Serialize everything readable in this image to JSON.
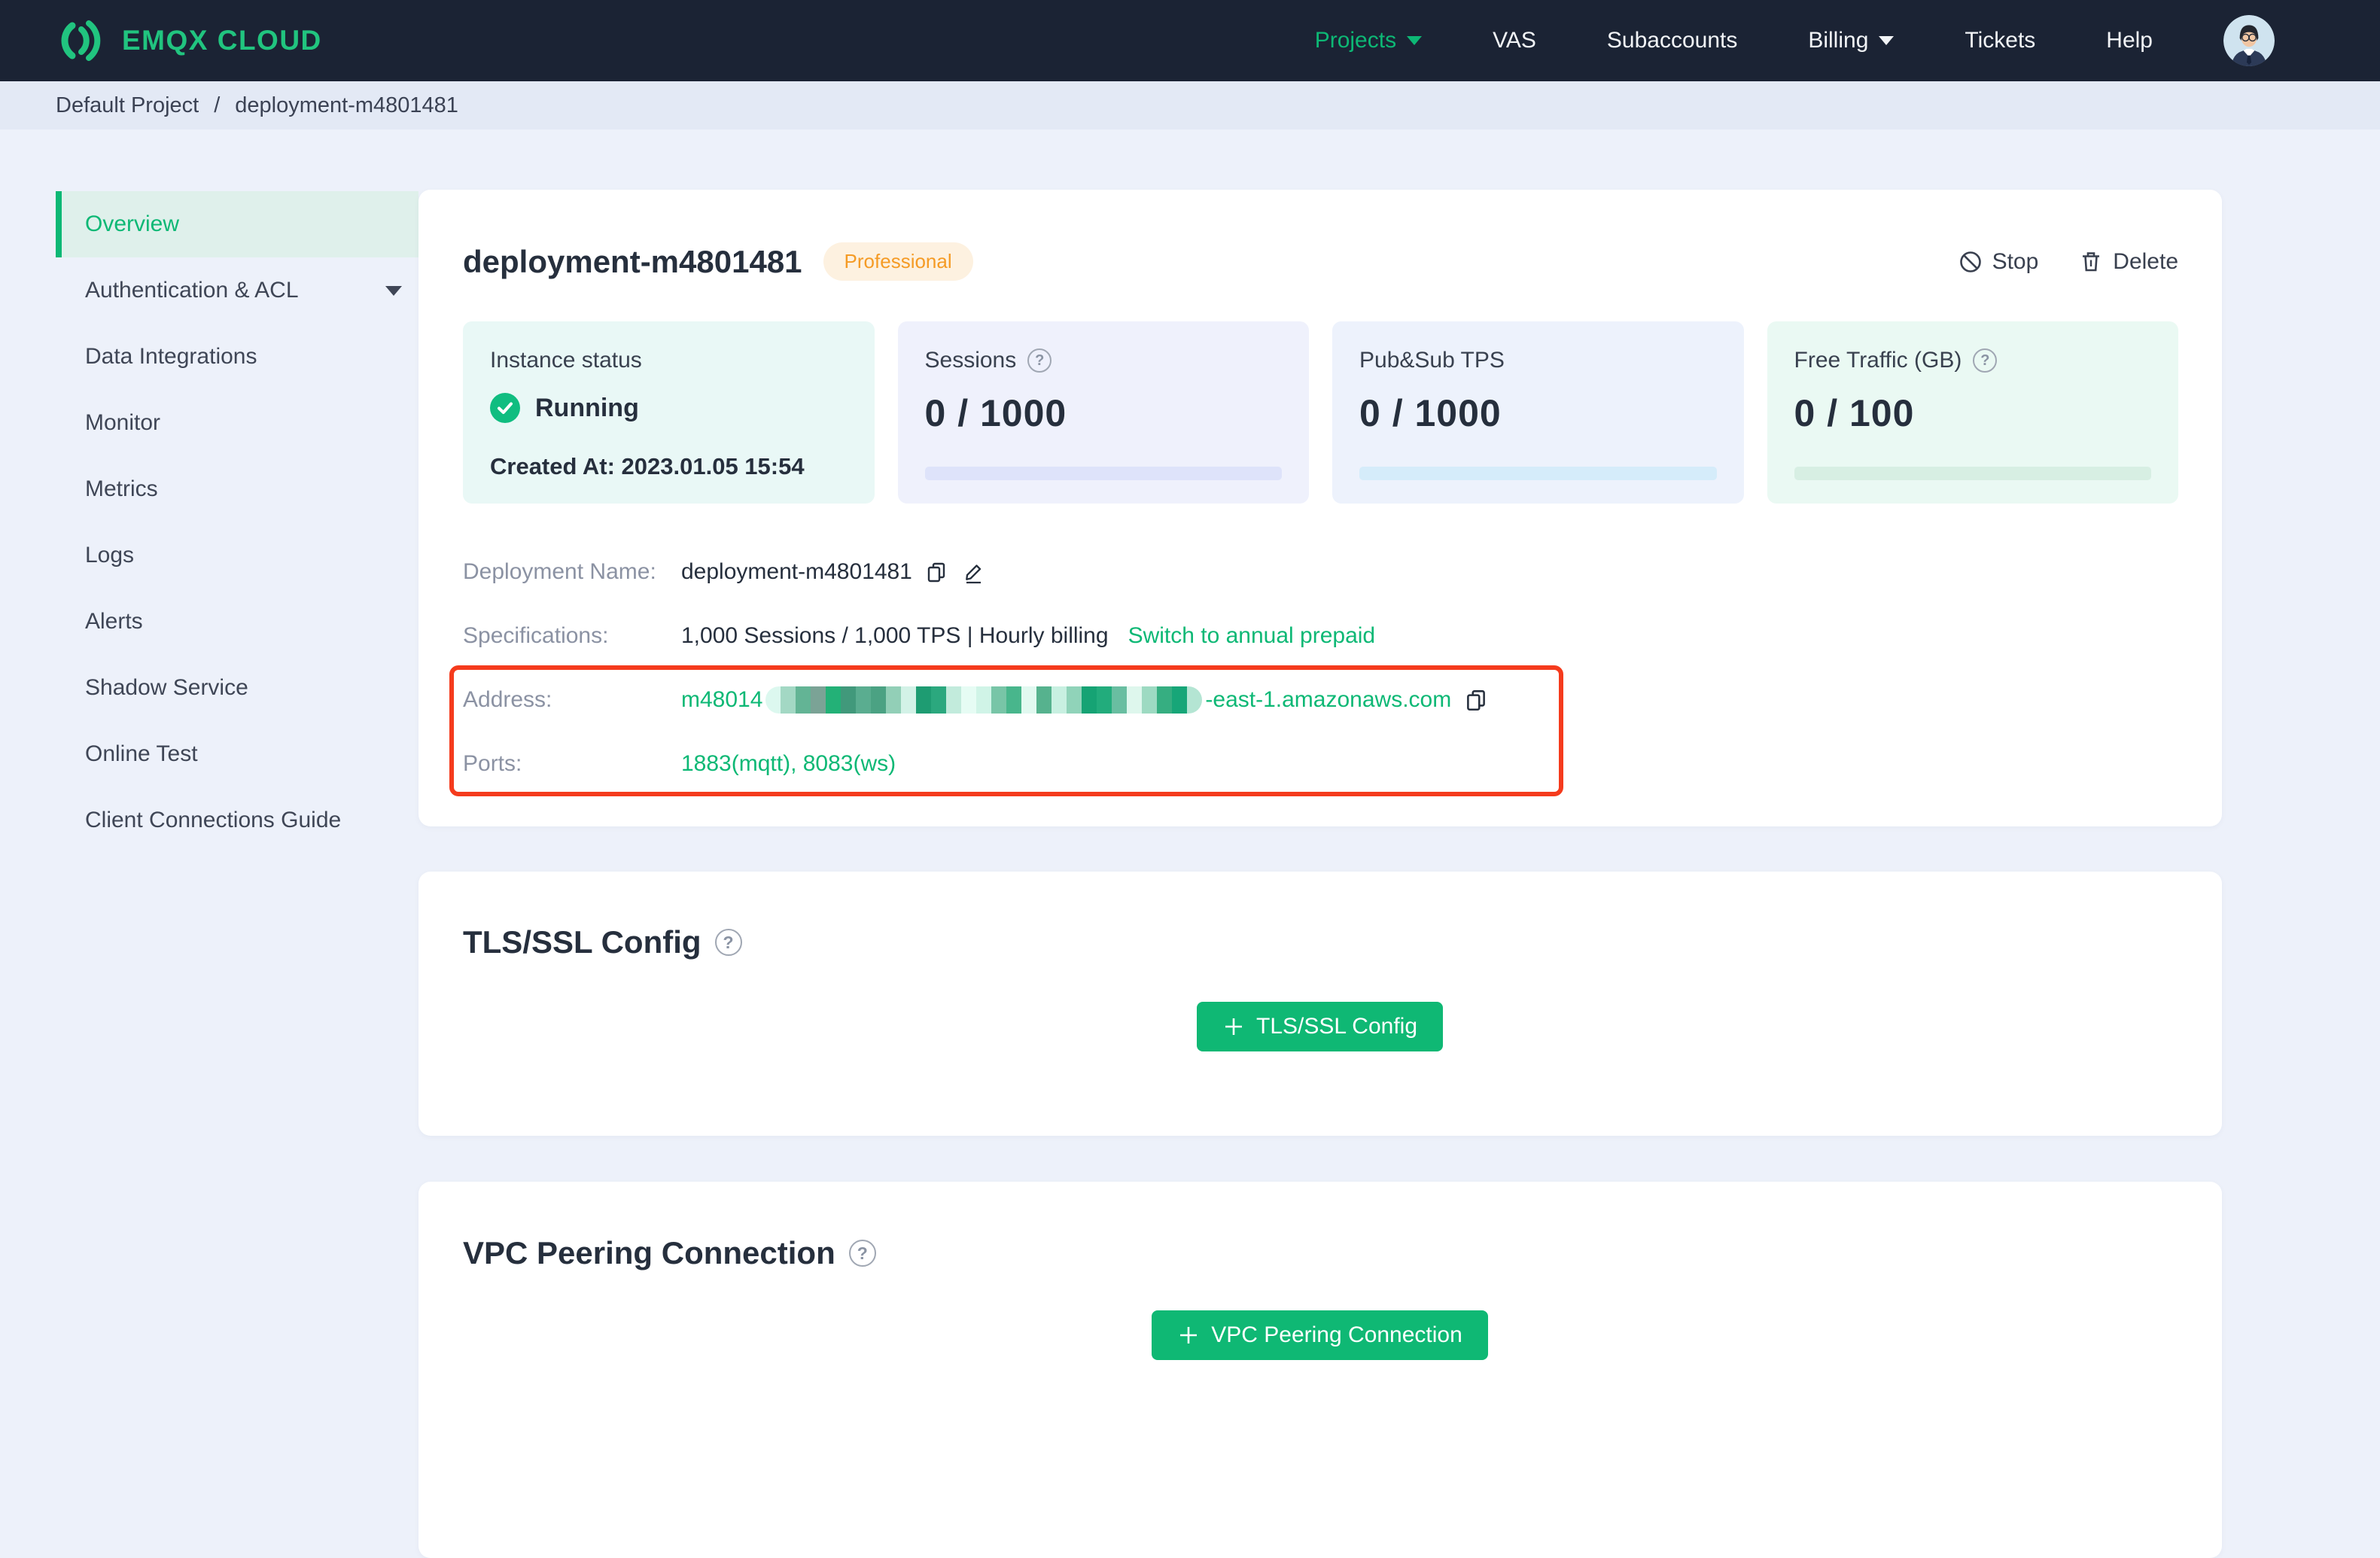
{
  "navbar": {
    "brand": "EMQX CLOUD",
    "items": [
      {
        "label": "Projects",
        "caret": true,
        "active": true
      },
      {
        "label": "VAS"
      },
      {
        "label": "Subaccounts"
      },
      {
        "label": "Billing",
        "caret": true
      },
      {
        "label": "Tickets"
      },
      {
        "label": "Help"
      }
    ]
  },
  "breadcrumb": {
    "project": "Default Project",
    "separator": "/",
    "current": "deployment-m4801481"
  },
  "sidebar": {
    "items": [
      {
        "label": "Overview",
        "active": true
      },
      {
        "label": "Authentication & ACL",
        "caret": true
      },
      {
        "label": "Data Integrations"
      },
      {
        "label": "Monitor"
      },
      {
        "label": "Metrics"
      },
      {
        "label": "Logs"
      },
      {
        "label": "Alerts"
      },
      {
        "label": "Shadow Service"
      },
      {
        "label": "Online Test"
      },
      {
        "label": "Client Connections Guide"
      }
    ]
  },
  "overview": {
    "title": "deployment-m4801481",
    "plan_badge": "Professional",
    "actions": {
      "stop_label": "Stop",
      "delete_label": "Delete"
    },
    "stats": [
      {
        "label": "Instance status",
        "status_text": "Running",
        "created_at": "Created At: 2023.01.05 15:54",
        "bg": "#e9f8f6"
      },
      {
        "label": "Sessions",
        "value": "0 / 1000",
        "bg": "#eff1fc",
        "track": "#dee3fa"
      },
      {
        "label": "Pub&Sub TPS",
        "value": "0 / 1000",
        "bg": "#edf2fc",
        "track": "#d5ecfa"
      },
      {
        "label": "Free Traffic (GB)",
        "value": "0 / 100",
        "bg": "#eaf9f3",
        "track": "#d7efe3"
      }
    ],
    "details": {
      "name_label": "Deployment Name:",
      "name_value": "deployment-m4801481",
      "spec_label": "Specifications:",
      "spec_value": "1,000 Sessions / 1,000 TPS | Hourly billing",
      "spec_link": "Switch to annual prepaid",
      "address_label": "Address:",
      "address_prefix": "m48014",
      "address_suffix": "-east-1.amazonaws.com",
      "ports_label": "Ports:",
      "ports_value": "1883(mqtt), 8083(ws)"
    }
  },
  "tls_section": {
    "title": "TLS/SSL Config",
    "button_label": "TLS/SSL Config"
  },
  "vpc_section": {
    "title": "VPC Peering Connection",
    "button_label": "VPC Peering Connection"
  },
  "icons": {
    "help_glyph": "?"
  },
  "colors": {
    "navbar_bg": "#1b2334",
    "accent_green": "#0db875",
    "brand_green": "#21c47f",
    "button_green": "#0fb874",
    "sidebar_active_bg": "#dff0eb",
    "badge_bg": "#fdf1e0",
    "badge_text": "#f59b25",
    "annotation_red": "#f53b1d",
    "status_check_green": "#10bd80",
    "breadcrumb_bg": "#e3e9f5",
    "page_bg": "#edf1fa"
  },
  "redaction": {
    "blocks": [
      "#dcf8ef",
      "#a3d8c4",
      "#63b495",
      "#7ba396",
      "#23b177",
      "#41997b",
      "#5aad90",
      "#4ba283",
      "#92cfb7",
      "#d3f2e7",
      "#1e9c72",
      "#2ba87e",
      "#c2ebdc",
      "#e6fcf4",
      "#d0f4e7",
      "#78c5a7",
      "#48b68c",
      "#e1f9f0",
      "#56b28e",
      "#c8f0e1",
      "#90d3b9",
      "#16a374",
      "#22ac7c",
      "#69bea1",
      "#def7ed",
      "#9ddac2",
      "#36ae81",
      "#17a678",
      "#b4e5d3"
    ]
  }
}
